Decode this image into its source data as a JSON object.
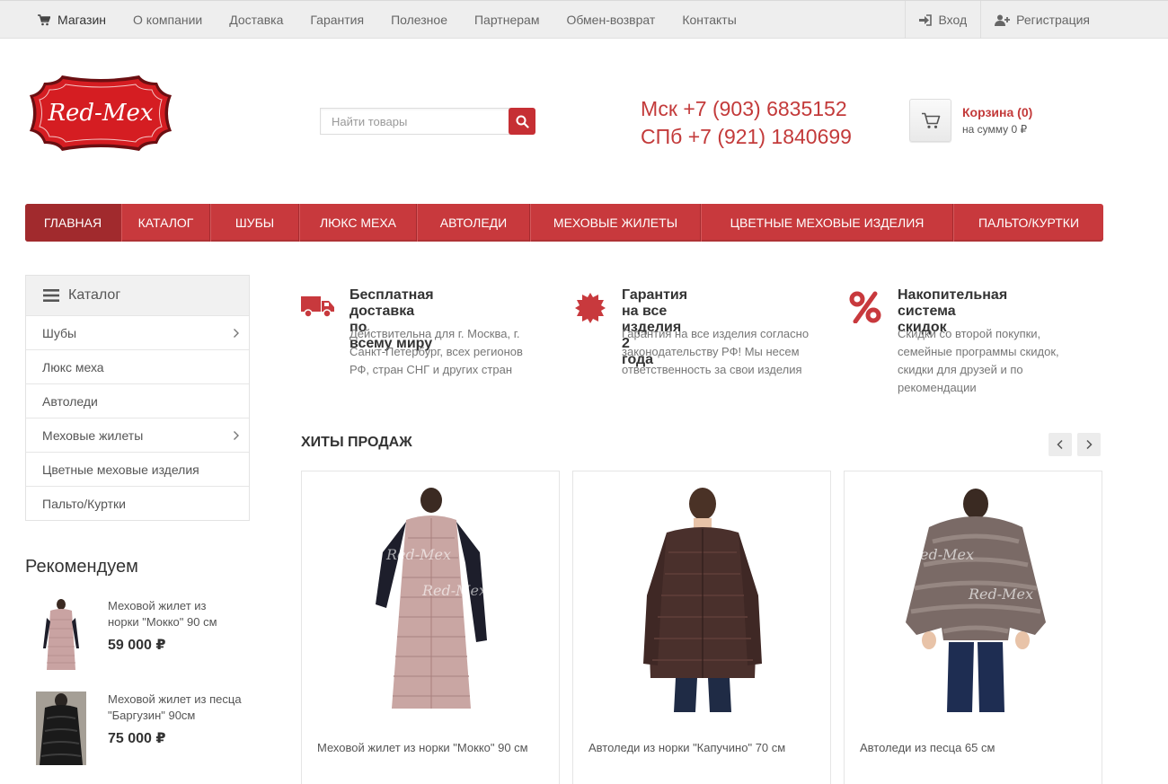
{
  "topnav": {
    "items": [
      "Магазин",
      "О компании",
      "Доставка",
      "Гарантия",
      "Полезное",
      "Партнерам",
      "Обмен-возврат",
      "Контакты"
    ],
    "login": "Вход",
    "register": "Регистрация"
  },
  "header": {
    "logo_text": "Red-Mex",
    "search_placeholder": "Найти товары",
    "phone_msk": "Мск +7 (903) 6835152",
    "phone_spb": "СПб +7 (921) 1840699",
    "cart_title": "Корзина (0)",
    "cart_sum": "на сумму 0 ₽"
  },
  "mainnav": {
    "items": [
      "ГЛАВНАЯ",
      "КАТАЛОГ",
      "ШУБЫ",
      "ЛЮКС МЕХА",
      "АВТОЛЕДИ",
      "МЕХОВЫЕ ЖИЛЕТЫ",
      "ЦВЕТНЫЕ МЕХОВЫЕ ИЗДЕЛИЯ",
      "ПАЛЬТО/КУРТКИ"
    ],
    "active": "ГЛАВНАЯ"
  },
  "catalog": {
    "title": "Каталог",
    "items": [
      {
        "label": "Шубы",
        "has_sub": true
      },
      {
        "label": "Люкс меха",
        "has_sub": false
      },
      {
        "label": "Автоледи",
        "has_sub": false
      },
      {
        "label": "Меховые жилеты",
        "has_sub": true
      },
      {
        "label": "Цветные меховые изделия",
        "has_sub": false
      },
      {
        "label": "Пальто/Куртки",
        "has_sub": false
      }
    ]
  },
  "recommend": {
    "title": "Рекомендуем",
    "items": [
      {
        "name_line1": "Меховой жилет из",
        "name_line2": "норки \"Мокко\" 90 см",
        "price": "59 000 ₽"
      },
      {
        "name_line1": "Меховой жилет из песца",
        "name_line2": "\"Баргузин\" 90см",
        "price": "75 000 ₽"
      }
    ]
  },
  "features": [
    {
      "icon": "truck-icon",
      "title_line1": "Бесплатная доставка по",
      "title_line2": "всему миру",
      "desc": [
        "Действительна для г. Москва, г.",
        "Санкт-Петербург, всех регионов",
        "РФ, стран СНГ и других стран"
      ]
    },
    {
      "icon": "badge-icon",
      "title_line1": "Гарантия на все изделия 2",
      "title_line2": "года",
      "desc": [
        "Гарантия на все изделия согласно",
        "законодательству РФ! Мы несем",
        "ответственность за свои изделия"
      ]
    },
    {
      "icon": "percent-icon",
      "title_line1": "Накопительная система",
      "title_line2": "скидок",
      "desc": [
        "Скидки со второй покупки,",
        "семейные программы скидок,",
        "скидки для друзей и по",
        "рекомендации"
      ]
    }
  ],
  "hits": {
    "title": "ХИТЫ ПРОДАЖ",
    "products": [
      {
        "name": "Меховой жилет из норки \"Мокко\" 90 см",
        "watermark": "Red-Mex"
      },
      {
        "name": "Автоледи из норки \"Капучино\" 70 см",
        "watermark": ""
      },
      {
        "name": "Автоледи из песца 65 см",
        "watermark": "Red-Mex"
      }
    ]
  },
  "colors": {
    "brand_red": "#c8393d",
    "brand_red_dark": "#a12a2d",
    "phone_red": "#c33a3a"
  }
}
